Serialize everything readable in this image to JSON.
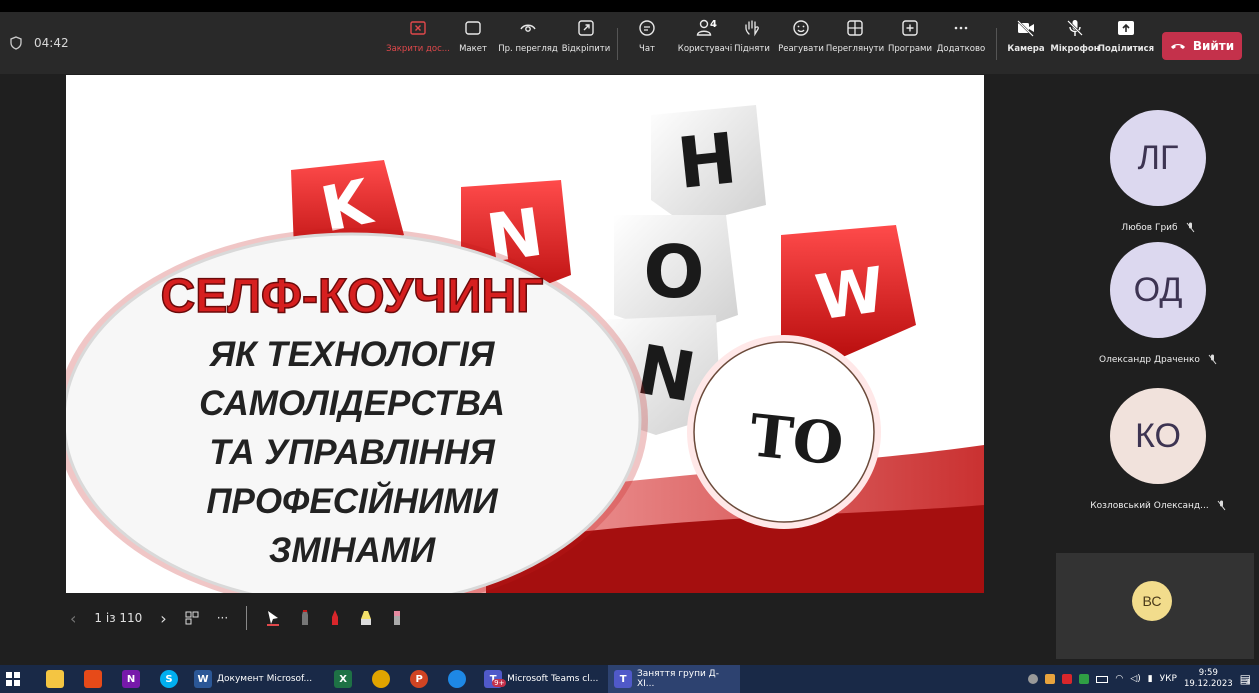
{
  "meeting": {
    "timer": "04:42"
  },
  "toolbar": {
    "stop_presenting": "Закрити дос...",
    "layout": "Макет",
    "preview": "Пр. перегляд",
    "pop_out": "Відкріпити",
    "chat": "Чат",
    "people": "Користувачі",
    "people_count": "4",
    "raise": "Підняти",
    "react": "Реагувати",
    "view": "Переглянути",
    "apps": "Програми",
    "more": "Додатково",
    "camera": "Камера",
    "mic": "Мікрофон",
    "share": "Поділитися",
    "leave": "Вийти"
  },
  "slide": {
    "title": "СЕЛФ-КОУЧИНГ",
    "lines": [
      "ЯК ТЕХНОЛОГІЯ",
      "САМОЛІДЕРСТВА",
      "ТА УПРАВЛІННЯ",
      "ПРОФЕСІЙНИМИ",
      "ЗМІНАМИ"
    ],
    "cubes": {
      "k": "K",
      "n": "N",
      "h": "H",
      "o": "O",
      "w": "W",
      "n2": "N",
      "to": "TO"
    }
  },
  "slide_controls": {
    "counter": "1 із 110"
  },
  "participants": [
    {
      "initials": "ЛГ",
      "name": "Любов Гриб",
      "color": "#dcd8ef"
    },
    {
      "initials": "ОД",
      "name": "Олександр Драченко",
      "color": "#dcd8ef"
    },
    {
      "initials": "КО",
      "name": "Козловський Олександ...",
      "color": "#f1e2dc"
    }
  ],
  "self": {
    "initials": "ВС"
  },
  "taskbar": {
    "word_label": "Документ Microsof...",
    "teams1_label": "Microsoft Teams cl...",
    "teams2_label": "Заняття групи Д-ХІ...",
    "teams_badge": "9+",
    "lang": "УКР",
    "time": "9:59",
    "date": "19.12.2023",
    "notif": "3"
  }
}
